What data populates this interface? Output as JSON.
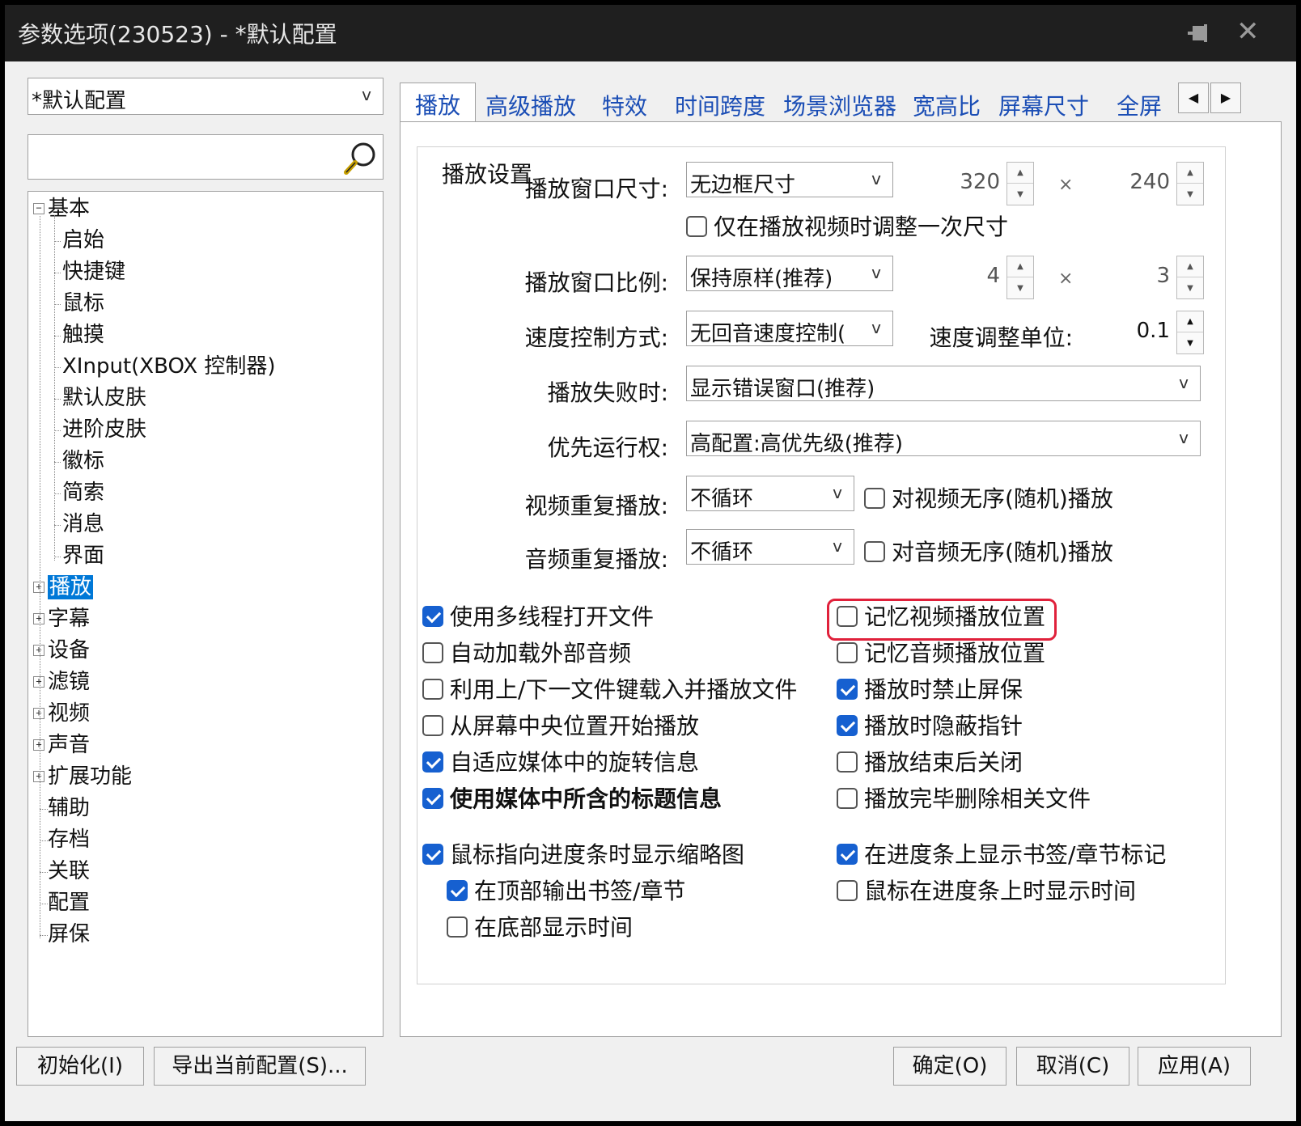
{
  "window": {
    "title": "参数选项(230523) - *默认配置"
  },
  "profile_combo": {
    "value": "*默认配置"
  },
  "search": {
    "value": ""
  },
  "tree": {
    "basic": "基本",
    "basic_children": [
      "启始",
      "快捷键",
      "鼠标",
      "触摸",
      "XInput(XBOX 控制器)",
      "默认皮肤",
      "进阶皮肤",
      "徽标",
      "简索",
      "消息",
      "界面"
    ],
    "expandable": [
      "播放",
      "字幕",
      "设备",
      "滤镜",
      "视频",
      "声音",
      "扩展功能"
    ],
    "leaves": [
      "辅助",
      "存档",
      "关联",
      "配置",
      "屏保"
    ],
    "selected": "播放"
  },
  "tabs": [
    "播放",
    "高级播放",
    "特效",
    "时间跨度",
    "场景浏览器",
    "宽高比",
    "屏幕尺寸",
    "全屏"
  ],
  "active_tab": "播放",
  "group": {
    "title": "播放设置",
    "window_size": {
      "label": "播放窗口尺寸:",
      "value": "无边框尺寸",
      "width": "320",
      "height": "240"
    },
    "resize_once": {
      "label": "仅在播放视频时调整一次尺寸",
      "checked": false
    },
    "window_ratio": {
      "label": "播放窗口比例:",
      "value": "保持原样(推荐)",
      "w": "4",
      "h": "3"
    },
    "speed_mode": {
      "label": "速度控制方式:",
      "value": "无回音速度控制(",
      "unit_label": "速度调整单位:",
      "unit_value": "0.1"
    },
    "on_fail": {
      "label": "播放失败时:",
      "value": "显示错误窗口(推荐)"
    },
    "priority": {
      "label": "优先运行权:",
      "value": "高配置:高优先级(推荐)"
    },
    "video_repeat": {
      "label": "视频重复播放:",
      "value": "不循环",
      "random_label": "对视频无序(随机)播放"
    },
    "audio_repeat": {
      "label": "音频重复播放:",
      "value": "不循环",
      "random_label": "对音频无序(随机)播放"
    },
    "times_sign": "×"
  },
  "checks_left": [
    {
      "label": "使用多线程打开文件",
      "checked": true
    },
    {
      "label": "自动加载外部音频",
      "checked": false
    },
    {
      "label": "利用上/下一文件键载入并播放文件",
      "checked": false
    },
    {
      "label": "从屏幕中央位置开始播放",
      "checked": false
    },
    {
      "label": "自适应媒体中的旋转信息",
      "checked": true
    },
    {
      "label": "使用媒体中所含的标题信息",
      "checked": true
    }
  ],
  "checks_right": [
    {
      "label": "记忆视频播放位置",
      "checked": false
    },
    {
      "label": "记忆音频播放位置",
      "checked": false
    },
    {
      "label": "播放时禁止屏保",
      "checked": true
    },
    {
      "label": "播放时隐蔽指针",
      "checked": true
    },
    {
      "label": "播放结束后关闭",
      "checked": false
    },
    {
      "label": "播放完毕删除相关文件",
      "checked": false
    }
  ],
  "checks_bottom_left": [
    {
      "label": "鼠标指向进度条时显示缩略图",
      "checked": true
    },
    {
      "label": "在顶部输出书签/章节",
      "checked": true
    },
    {
      "label": "在底部显示时间",
      "checked": false
    }
  ],
  "checks_bottom_right": [
    {
      "label": "在进度条上显示书签/章节标记",
      "checked": true
    },
    {
      "label": "鼠标在进度条上时显示时间",
      "checked": false
    }
  ],
  "buttons": {
    "init": "初始化(I)",
    "export": "导出当前配置(S)...",
    "ok": "确定(O)",
    "cancel": "取消(C)",
    "apply": "应用(A)"
  },
  "icons": {
    "pin": "pin-icon",
    "close": "close-icon",
    "search": "search-icon",
    "tab_prev": "tab-prev-icon",
    "tab_next": "tab-next-icon"
  },
  "colors": {
    "accent": "#0078d7",
    "checkbox_on": "#1660d0",
    "highlight_ring": "#e0213b",
    "tab_text": "#1a4db5"
  }
}
